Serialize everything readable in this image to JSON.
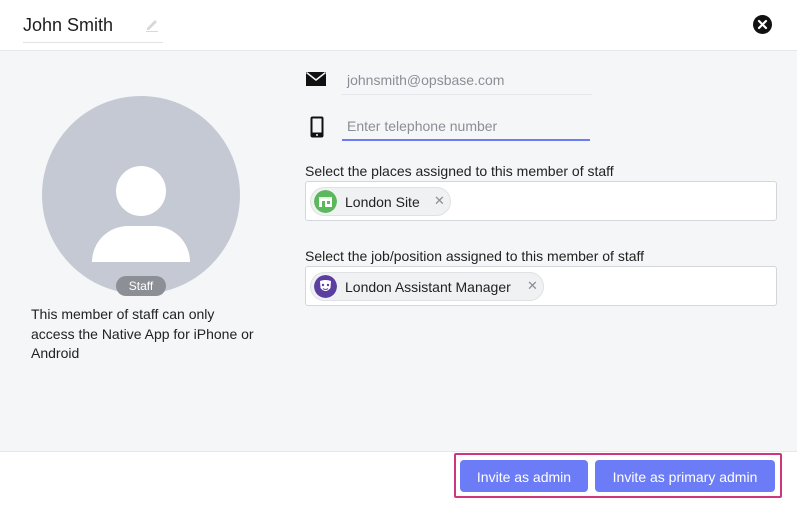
{
  "header": {
    "name": "John Smith"
  },
  "profile": {
    "role_badge": "Staff",
    "note": "This member of staff can only access the Native App for iPhone or Android"
  },
  "contact": {
    "email": "johnsmith@opsbase.com",
    "phone_value": "",
    "phone_placeholder": "Enter telephone number"
  },
  "places": {
    "label": "Select the places assigned to this member of staff",
    "selected": [
      {
        "label": "London Site",
        "icon": "shop-icon",
        "color": "#5cb85c"
      }
    ]
  },
  "positions": {
    "label": "Select the job/position assigned to this member of staff",
    "selected": [
      {
        "label": "London Assistant Manager",
        "icon": "mask-icon",
        "color": "#5b3fa0"
      }
    ]
  },
  "actions": {
    "invite_admin": "Invite as admin",
    "invite_primary_admin": "Invite as primary admin"
  },
  "colors": {
    "accent": "#6b7cf6",
    "highlight": "#d0357f"
  }
}
